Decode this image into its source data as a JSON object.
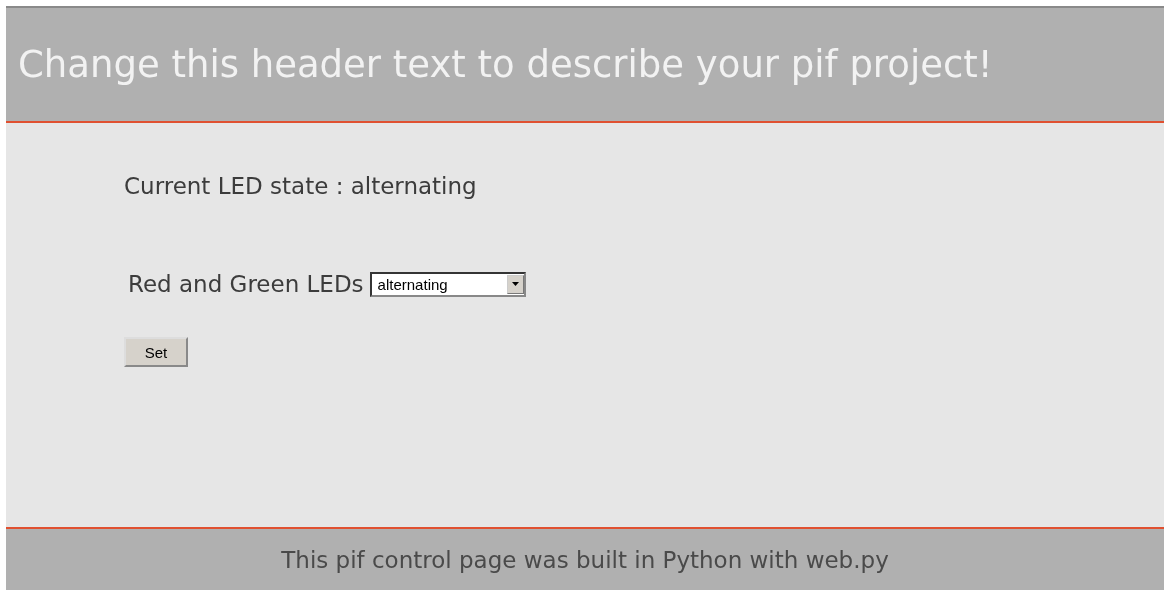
{
  "header": {
    "title": "Change this header text to describe your pif project!"
  },
  "status": {
    "text": "Current LED state : alternating"
  },
  "form": {
    "label": "Red and Green LEDs",
    "dropdown": {
      "value": "alternating"
    },
    "button": "Set"
  },
  "footer": {
    "text": "This pif control page was built in Python with web.py"
  }
}
